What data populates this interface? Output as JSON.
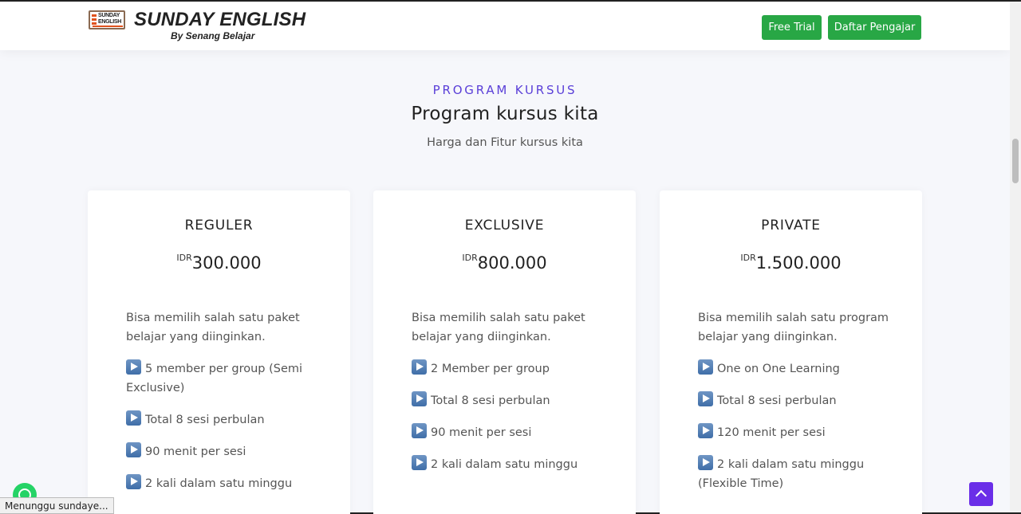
{
  "header": {
    "logo_badge_line1": "SUNDAY",
    "logo_badge_line2": "ENGLISH",
    "logo_title": "SUNDAY ENGLISH",
    "logo_subtitle": "By Senang Belajar",
    "free_trial_label": "Free Trial",
    "daftar_pengajar_label": "Daftar Pengajar"
  },
  "section": {
    "eyebrow": "PROGRAM KURSUS",
    "title": "Program kursus kita",
    "subtitle": "Harga dan Fitur kursus kita"
  },
  "plans": [
    {
      "name": "REGULER",
      "currency": "IDR",
      "price": "300.000",
      "description": "Bisa memilih salah satu paket belajar yang diinginkan.",
      "features": [
        "5 member per group (Semi Exclusive)",
        "Total 8 sesi perbulan",
        "90 menit per sesi",
        "2 kali dalam satu minggu"
      ]
    },
    {
      "name": "EXCLUSIVE",
      "currency": "IDR",
      "price": "800.000",
      "description": "Bisa memilih salah satu paket belajar yang diinginkan.",
      "features": [
        "2 Member per group",
        "Total 8 sesi perbulan",
        "90 menit per sesi",
        "2 kali dalam satu minggu"
      ]
    },
    {
      "name": "PRIVATE",
      "currency": "IDR",
      "price": "1.500.000",
      "description": "Bisa memilih salah satu program belajar yang diinginkan.",
      "features": [
        "One on One Learning",
        "Total 8 sesi perbulan",
        "120 menit per sesi",
        "2 kali dalam satu minggu (Flexible Time)"
      ]
    }
  ],
  "status_bar": {
    "text": "Menunggu sundaye..."
  },
  "colors": {
    "accent_purple": "#5a3fd8",
    "button_green": "#28a745",
    "back_top_purple": "#6a2ee8",
    "page_bg": "#f6f7fb"
  }
}
